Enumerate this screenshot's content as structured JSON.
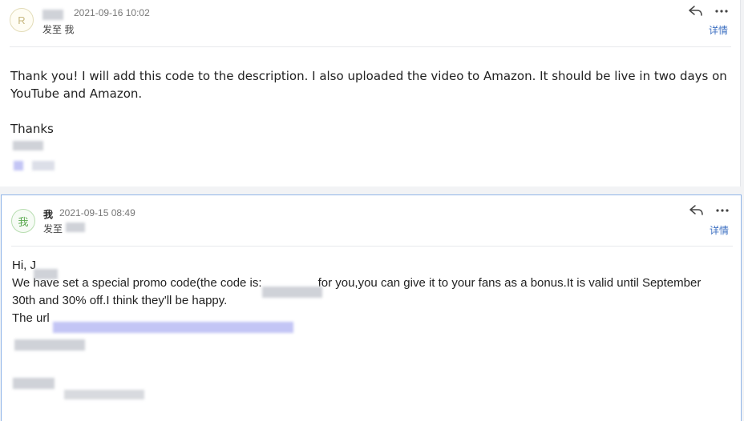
{
  "message1": {
    "avatar_letter": "R",
    "timestamp": "2021-09-16 10:02",
    "recipient_line": "发至 我",
    "details_label": "详情",
    "body_line1": "Thank you!  I will add this code to the description.  I also uploaded the video to Amazon.  It should be live in two days on",
    "body_line2": "YouTube and Amazon.",
    "thanks": "Thanks"
  },
  "message2": {
    "avatar_letter": "我",
    "sender": "我",
    "timestamp": "2021-09-15 08:49",
    "recipient_prefix": "发至",
    "details_label": "详情",
    "greeting": "Hi, J",
    "line1": "We have set a special promo code(the code is:",
    "line1_end": "for you,you can give it to your fans as a bonus.It is valid until September",
    "line2": "30th and 30% off.I think they'll be happy.",
    "line3": "The url "
  },
  "icons": {
    "reply": "reply-icon",
    "more": "more-icon"
  },
  "colors": {
    "link_blue": "#3c6fc1",
    "selected_border": "#8fb4e8"
  }
}
